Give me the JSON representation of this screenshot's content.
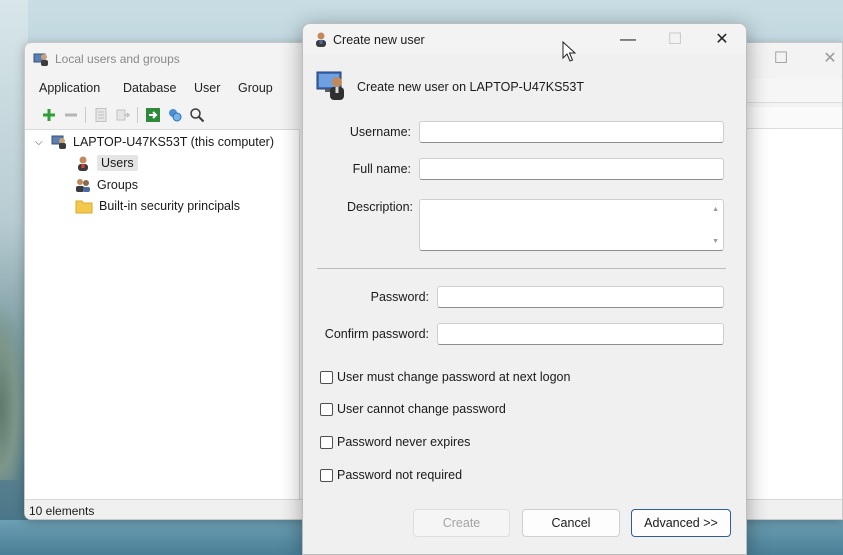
{
  "main_window": {
    "title": "Local users and groups",
    "menu": [
      "Application",
      "Database",
      "User",
      "Group"
    ],
    "tree": {
      "root": "LAPTOP-U47KS53T (this computer)",
      "children": [
        "Users",
        "Groups",
        "Built-in security principals"
      ]
    },
    "status": "10 elements",
    "icons": [
      "add-icon",
      "remove-icon",
      "properties-icon",
      "export-icon",
      "run-icon",
      "refresh-icon",
      "search-icon"
    ]
  },
  "dialog": {
    "title": "Create new user",
    "heading": "Create new user on LAPTOP-U47KS53T",
    "fields": {
      "username_label": "Username:",
      "fullname_label": "Full name:",
      "description_label": "Description:",
      "password_label": "Password:",
      "confirm_label": "Confirm password:",
      "username_value": "",
      "fullname_value": "",
      "description_value": "",
      "password_value": "",
      "confirm_value": ""
    },
    "options": [
      {
        "label": "User must change password at next logon",
        "checked": false
      },
      {
        "label": "User cannot change password",
        "checked": false
      },
      {
        "label": "Password never expires",
        "checked": false
      },
      {
        "label": "Password not required",
        "checked": false
      }
    ],
    "buttons": {
      "create": "Create",
      "cancel": "Cancel",
      "advanced": "Advanced >>"
    },
    "controls": {
      "minimize": "—",
      "maximize": "☐",
      "close": "✕"
    }
  },
  "colors": {
    "accent_border": "#2d5e9a",
    "add_green": "#2e9e3a",
    "folder_yellow": "#f2c94c"
  }
}
